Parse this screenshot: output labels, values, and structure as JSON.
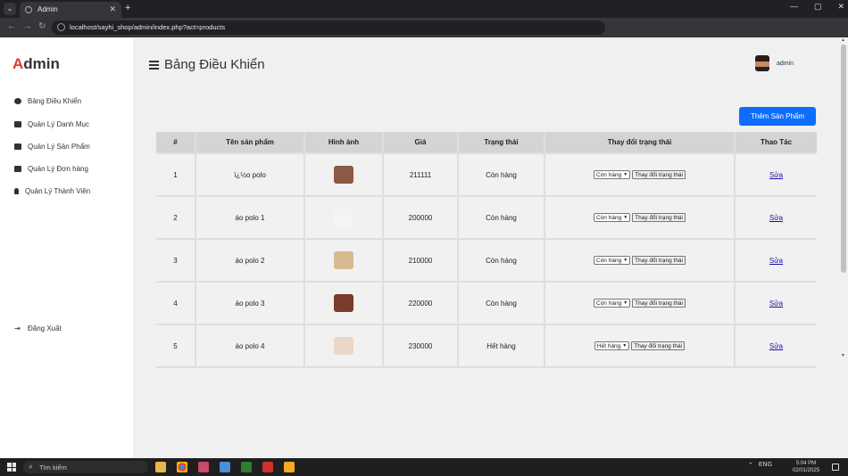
{
  "browser": {
    "tab_title": "Admin",
    "tab_close": "✕",
    "new_tab": "+",
    "window_controls": [
      "—",
      "▢",
      "✕"
    ],
    "url": "localhost/sayhi_shop/admin/index.php?act=products",
    "nav": [
      "←",
      "→",
      "↻"
    ]
  },
  "sidebar": {
    "logo_first": "A",
    "logo_rest": "dmin",
    "items": [
      {
        "label": "Bảng Điều Khiển",
        "icon": "dashboard-icon"
      },
      {
        "label": "Quản Lý Danh Mục",
        "icon": "folder-icon"
      },
      {
        "label": "Quản Lý Sản Phẩm",
        "icon": "product-folder-icon"
      },
      {
        "label": "Quản Lý Đơn hàng",
        "icon": "bag-icon"
      },
      {
        "label": "Quản Lý Thành Viên",
        "icon": "user-icon"
      }
    ],
    "logout": {
      "label": "Đăng Xuất",
      "icon": "logout-icon"
    }
  },
  "header": {
    "title": "Bảng Điều Khiển",
    "user_name": "admin"
  },
  "add_button": "Thêm Sản Phẩm",
  "table": {
    "headers": [
      "#",
      "Tên sản phẩm",
      "Hình ảnh",
      "Giá",
      "Trạng thái",
      "Thay đổi trạng thái",
      "Thao Tác"
    ],
    "rows": [
      {
        "id": "1",
        "name": "ï¿½o polo",
        "image_color": "#8a5a44",
        "price": "211111",
        "status": "Còn hàng",
        "select": "Còn hàng",
        "change": "Thay đổi trạng thái",
        "action": "Sửa"
      },
      {
        "id": "2",
        "name": "áo polo 1",
        "image_color": "#f4f4f4",
        "price": "200000",
        "status": "Còn hàng",
        "select": "Còn hàng",
        "change": "Thay đổi trạng thái",
        "action": "Sửa"
      },
      {
        "id": "3",
        "name": "áo polo 2",
        "image_color": "#d9b98f",
        "price": "210000",
        "status": "Còn hàng",
        "select": "Còn hàng",
        "change": "Thay đổi trạng thái",
        "action": "Sửa"
      },
      {
        "id": "4",
        "name": "áo polo 3",
        "image_color": "#7a3b2a",
        "price": "220000",
        "status": "Còn hàng",
        "select": "Còn hàng",
        "change": "Thay đổi trạng thái",
        "action": "Sửa"
      },
      {
        "id": "5",
        "name": "áo polo 4",
        "image_color": "#ead7c8",
        "price": "230000",
        "status": "Hết hàng",
        "select": "Hết hàng",
        "change": "Thay đổi trạng thái",
        "action": "Sửa"
      }
    ]
  },
  "taskbar": {
    "search_placeholder": "Tìm kiếm",
    "language": "ENG",
    "time": "5:04 PM",
    "date": "02/01/2025"
  }
}
